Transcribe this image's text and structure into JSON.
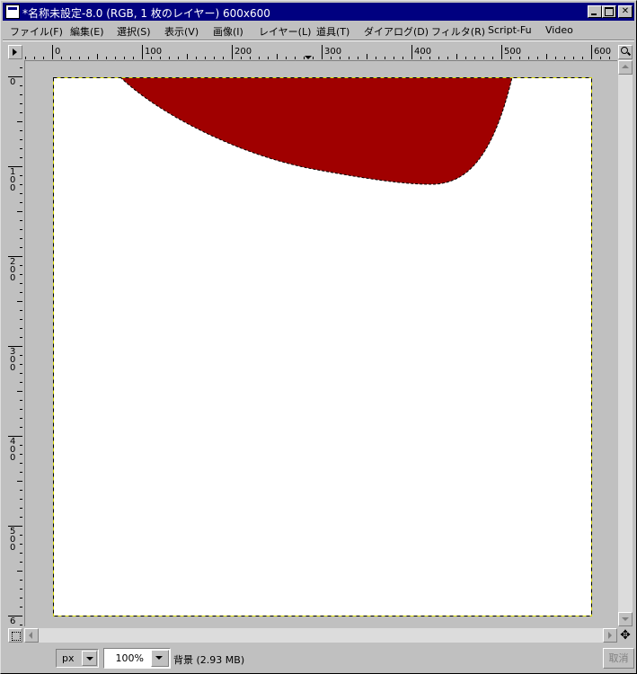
{
  "window": {
    "title": "*名称未設定-8.0 (RGB, 1 枚のレイヤー) 600x600"
  },
  "menu": {
    "items": [
      {
        "label": "ファイル(F)"
      },
      {
        "label": "編集(E)"
      },
      {
        "label": "選択(S)"
      },
      {
        "label": "表示(V)"
      },
      {
        "label": "画像(I)"
      },
      {
        "label": "レイヤー(L)"
      },
      {
        "label": "道具(T)"
      },
      {
        "label": "ダイアログ(D)"
      },
      {
        "label": "フィルタ(R)"
      },
      {
        "label": "Script-Fu"
      },
      {
        "label": "Video"
      }
    ]
  },
  "rulers": {
    "horizontal_labels": [
      "0",
      "100",
      "200",
      "300",
      "400",
      "500",
      "600"
    ],
    "vertical_labels": [
      "0",
      "100",
      "200",
      "300",
      "400",
      "500",
      "6"
    ]
  },
  "canvas": {
    "background": "#ffffff",
    "shape_fill": "#a00000",
    "image_size": "600x600"
  },
  "status": {
    "unit": "px",
    "zoom": "100%",
    "layer_info": "背景 (2.93 MB)",
    "cancel_label": "取消"
  },
  "icons": {
    "title_icon": "gimp-image-icon",
    "minimize": "minimize-icon",
    "maximize": "maximize-icon",
    "close": "close-icon",
    "ruler_menu": "ruler-menu-arrow-icon",
    "zoom": "zoom-magnifier-icon",
    "quickmask": "quick-mask-icon",
    "navigate": "navigate-cross-icon"
  }
}
